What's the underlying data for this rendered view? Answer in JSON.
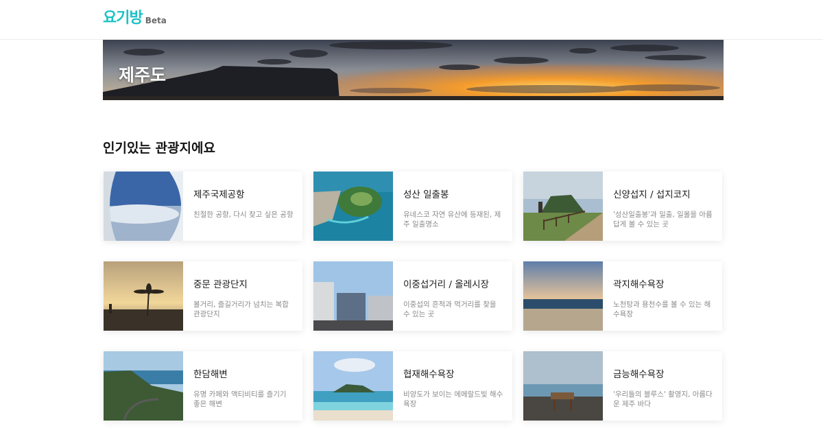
{
  "app": {
    "logo_text": "요기방",
    "logo_badge": "Beta",
    "brand_color": "#1ec1c6"
  },
  "hero": {
    "title": "제주도"
  },
  "section": {
    "title": "인기있는 관광지에요"
  },
  "places": [
    {
      "name": "제주국제공항",
      "desc": "친절한 공항, 다시 찾고 싶은 공항",
      "image": "airplane-window-photo"
    },
    {
      "name": "성산 일출봉",
      "desc": "유네스코 자연 유산에 등재된, 제주 일출명소",
      "image": "seongsan-aerial-photo"
    },
    {
      "name": "신양섭지 / 섭지코지",
      "desc": "'성산일출봉'과 일출, 일몰을 아름답게 볼 수 있는 곳",
      "image": "seopjikoji-photo"
    },
    {
      "name": "중문 관광단지",
      "desc": "볼거리, 즐길거리가 넘치는 복합관광단지",
      "image": "jungmun-sunset-photo"
    },
    {
      "name": "이중섭거리 / 올레시장",
      "desc": "이중섭의 흔적과 먹거리를 찾을 수 있는 곳",
      "image": "olle-market-photo"
    },
    {
      "name": "곽지해수욕장",
      "desc": "노천탕과 용천수를 볼 수 있는 해수욕장",
      "image": "gwakji-beach-photo"
    },
    {
      "name": "한담해변",
      "desc": "유명 카페와 액티비티를 즐기기 좋은 해변",
      "image": "handam-coast-photo"
    },
    {
      "name": "협재해수욕장",
      "desc": "비양도가 보이는 에메랄드빛 해수욕장",
      "image": "hyeopjae-beach-photo"
    },
    {
      "name": "금능해수욕장",
      "desc": "'우리들의 블루스' 촬영지, 아름다운 제주 바다",
      "image": "geumneung-beach-photo"
    }
  ]
}
